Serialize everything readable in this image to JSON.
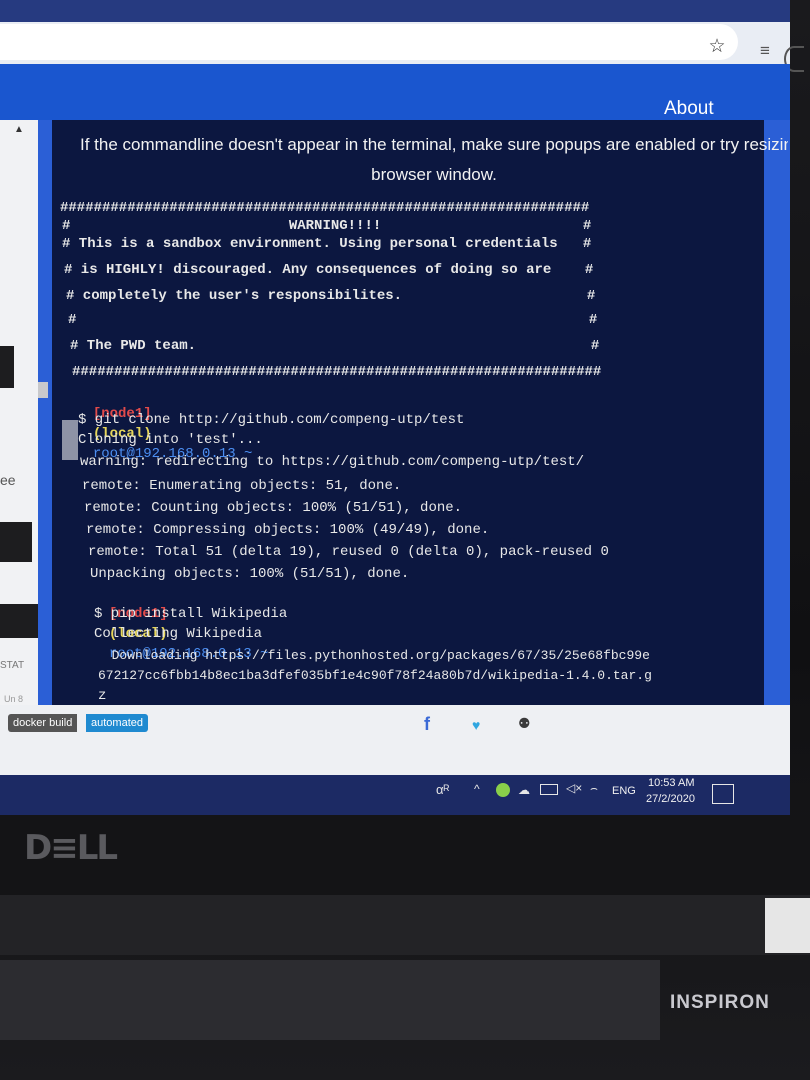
{
  "browser": {
    "star_label": "☆",
    "reading_list_label": "≡",
    "about_link": "About"
  },
  "left_panel": {
    "fragment_ee": "ee",
    "fragment_stat": "STAT",
    "fragment_ln": "Un 8"
  },
  "terminal": {
    "popup_note_line1": "If the commandline doesn't appear in the terminal, make sure popups are enabled or try resizing th",
    "popup_note_line2": "browser window.",
    "lines": [
      "###############################################################",
      "#                          WARNING!!!!                        #",
      "# This is a sandbox environment. Using personal credentials   #",
      "# is HIGHLY! discouraged. Any consequences of doing so are    #",
      "# completely the user's responsibilites.                      #",
      "#                                                             #",
      "# The PWD team.                                               #",
      "###############################################################"
    ],
    "prompt_node": "[node1]",
    "prompt_local": "(local)",
    "prompt_host": "root@192.168.0.13 ~",
    "cmd1": "$ git clone http://github.com/compeng-utp/test",
    "output1": [
      "Cloning into 'test'...",
      "warning: redirecting to https://github.com/compeng-utp/test/",
      "remote: Enumerating objects: 51, done.",
      "remote: Counting objects: 100% (51/51), done.",
      "remote: Compressing objects: 100% (49/49), done.",
      "remote: Total 51 (delta 19), reused 0 (delta 0), pack-reused 0",
      "Unpacking objects: 100% (51/51), done."
    ],
    "cmd2": "$ pip install Wikipedia",
    "output2": [
      "Collecting Wikipedia",
      "  Downloading https://files.pythonhosted.org/packages/67/35/25e68fbc99e",
      "672127cc6fbb14b8ec1ba3dfef035bf1e4c90f78f24a80b7d/wikipedia-1.4.0.tar.g",
      "z"
    ]
  },
  "footer": {
    "badge_left": "docker build",
    "badge_right": "automated",
    "facebook": "f",
    "twitter": "♥",
    "github": "⚉"
  },
  "taskbar": {
    "people": "αᴿ",
    "tray_up": "^",
    "volume": "◁×",
    "wifi": "⌢",
    "lang": "ENG",
    "time": "10:53 AM",
    "date": "27/2/2020"
  },
  "laptop": {
    "brand": "D≡LL",
    "model": "INSPIRON"
  }
}
